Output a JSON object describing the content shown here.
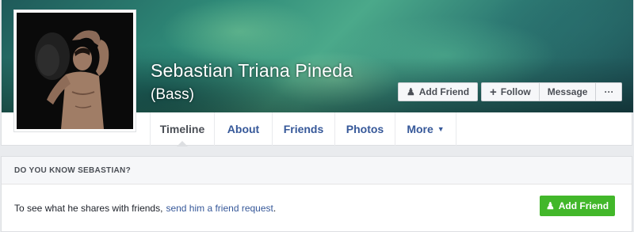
{
  "profile": {
    "name": "Sebastian Triana Pineda",
    "alternate_name": "(Bass)"
  },
  "cover_actions": {
    "add_friend_label": "Add Friend",
    "follow_label": "Follow",
    "message_label": "Message",
    "more_label": "···"
  },
  "tabs": [
    {
      "label": "Timeline",
      "active": true
    },
    {
      "label": "About"
    },
    {
      "label": "Friends"
    },
    {
      "label": "Photos"
    },
    {
      "label": "More"
    }
  ],
  "know_box": {
    "title": "DO YOU KNOW SEBASTIAN?",
    "text": "To see what he shares with friends,",
    "link_text": "send him a friend request",
    "period": ".",
    "button_label": "Add Friend"
  },
  "colors": {
    "link_blue": "#365899",
    "green": "#42b72a",
    "text_dark": "#1d2129"
  },
  "icons": {
    "add_friend": "person-plus-icon",
    "follow": "plus-icon",
    "more": "ellipsis-icon",
    "tab_more": "caret-down-icon"
  }
}
